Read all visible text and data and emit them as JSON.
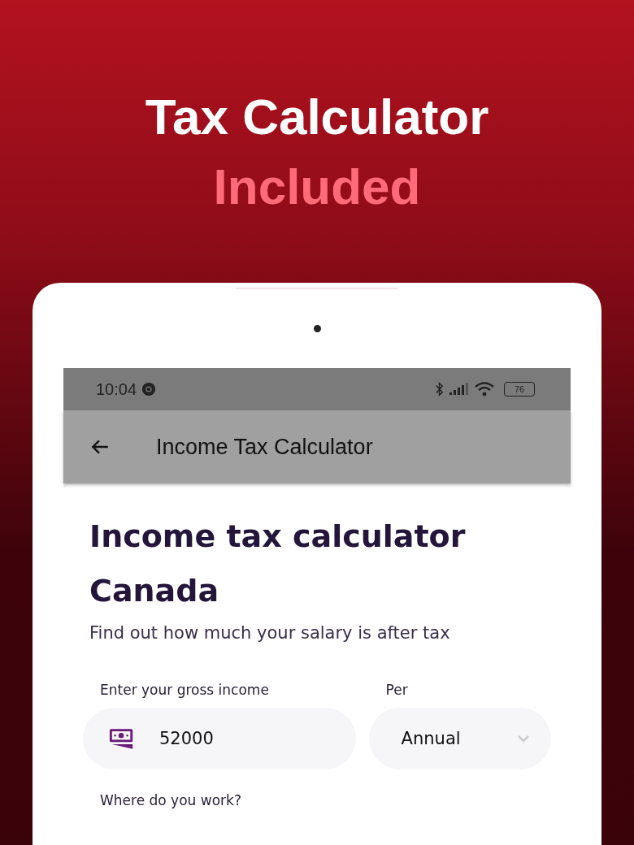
{
  "promo": {
    "title": "Tax Calculator",
    "subtitle": "Included"
  },
  "status_bar": {
    "time": "10:04",
    "battery": "76"
  },
  "app_bar": {
    "title": "Income Tax Calculator"
  },
  "page": {
    "heading": "Income tax calculator Canada",
    "subheading": "Find out how much your salary is after tax"
  },
  "form": {
    "income_label": "Enter your gross income",
    "income_value": "52000",
    "period_label": "Per",
    "period_value": "Annual",
    "location_label": "Where do you work?"
  }
}
